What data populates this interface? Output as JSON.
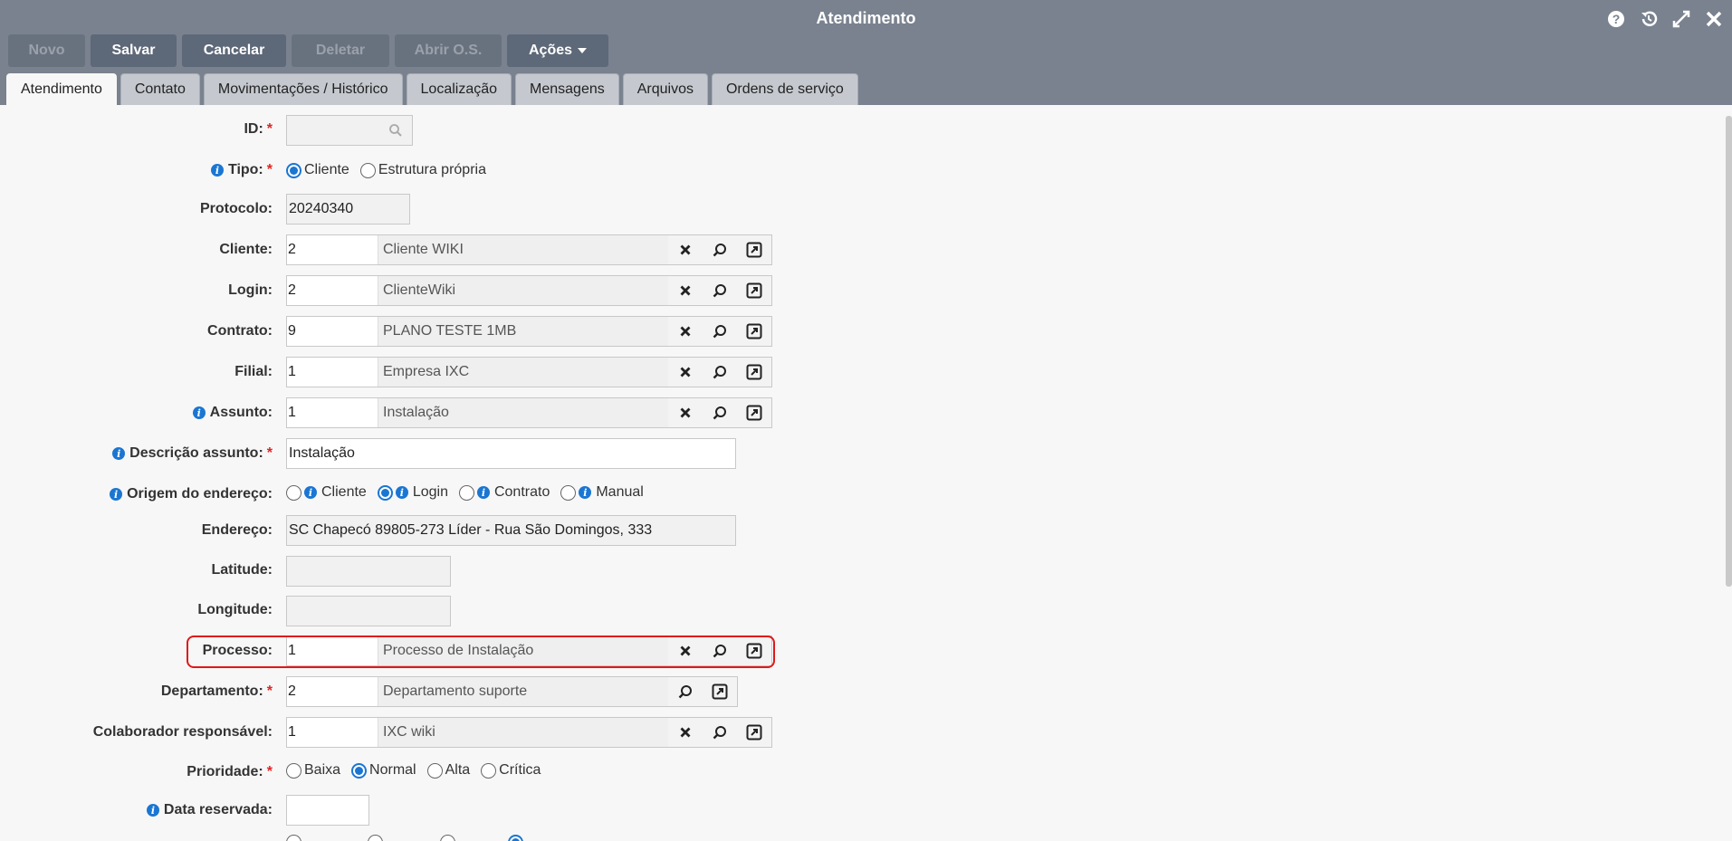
{
  "window": {
    "title": "Atendimento"
  },
  "toolbar": {
    "novo": "Novo",
    "salvar": "Salvar",
    "cancelar": "Cancelar",
    "deletar": "Deletar",
    "abrir_os": "Abrir O.S.",
    "acoes": "Ações"
  },
  "tabs": [
    "Atendimento",
    "Contato",
    "Movimentações / Histórico",
    "Localização",
    "Mensagens",
    "Arquivos",
    "Ordens de serviço"
  ],
  "form": {
    "id": {
      "label": "ID:",
      "value": ""
    },
    "tipo": {
      "label": "Tipo:",
      "options": [
        "Cliente",
        "Estrutura própria"
      ],
      "selected": "Cliente"
    },
    "protocolo": {
      "label": "Protocolo:",
      "value": "20240340"
    },
    "cliente": {
      "label": "Cliente:",
      "code": "2",
      "desc": "Cliente WIKI"
    },
    "login": {
      "label": "Login:",
      "code": "2",
      "desc": "ClienteWiki"
    },
    "contrato": {
      "label": "Contrato:",
      "code": "9",
      "desc": "PLANO TESTE 1MB"
    },
    "filial": {
      "label": "Filial:",
      "code": "1",
      "desc": "Empresa IXC"
    },
    "assunto": {
      "label": "Assunto:",
      "code": "1",
      "desc": "Instalação"
    },
    "descricao_assunto": {
      "label": "Descrição assunto:",
      "value": "Instalação"
    },
    "origem_endereco": {
      "label": "Origem do endereço:",
      "options": [
        "Cliente",
        "Login",
        "Contrato",
        "Manual"
      ],
      "selected": "Login"
    },
    "endereco": {
      "label": "Endereço:",
      "value": "SC Chapecó 89805-273 Líder - Rua São Domingos, 333"
    },
    "latitude": {
      "label": "Latitude:",
      "value": ""
    },
    "longitude": {
      "label": "Longitude:",
      "value": ""
    },
    "processo": {
      "label": "Processo:",
      "code": "1",
      "desc": "Processo de Instalação"
    },
    "departamento": {
      "label": "Departamento:",
      "code": "2",
      "desc": "Departamento suporte"
    },
    "colaborador": {
      "label": "Colaborador responsável:",
      "code": "1",
      "desc": "IXC wiki"
    },
    "prioridade": {
      "label": "Prioridade:",
      "options": [
        "Baixa",
        "Normal",
        "Alta",
        "Crítica"
      ],
      "selected": "Normal"
    },
    "data_reservada": {
      "label": "Data reservada:",
      "value": ""
    }
  },
  "colors": {
    "header": "#7a828f",
    "button": "#5d6878",
    "accent": "#1a76d2",
    "required": "#e02424",
    "highlight": "#e01818"
  }
}
